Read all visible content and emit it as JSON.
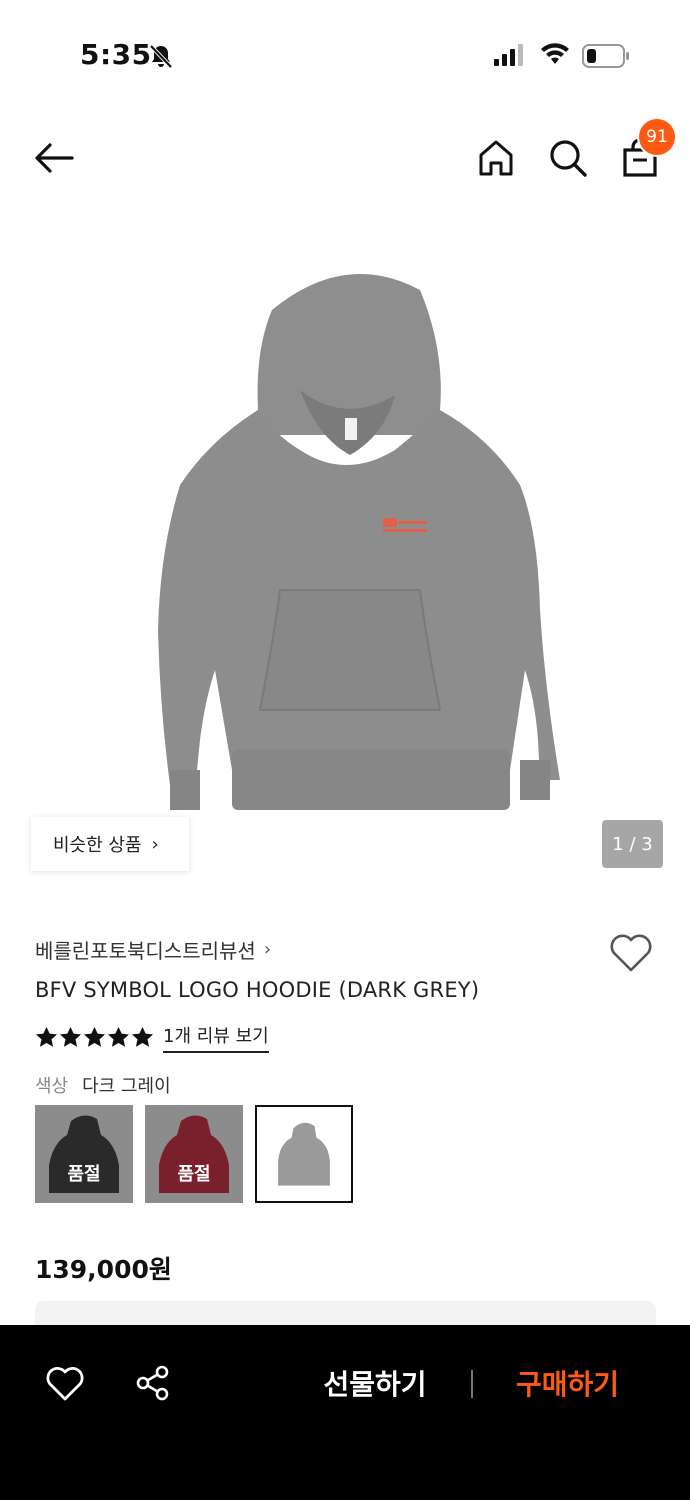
{
  "status_bar": {
    "time": "5:35",
    "icons": [
      "bell-slash-icon",
      "signal-icon",
      "wifi-icon",
      "battery-icon"
    ]
  },
  "header": {
    "icons": [
      "back-arrow-icon",
      "home-icon",
      "search-icon",
      "shopping-bag-icon"
    ],
    "cart_count": "91"
  },
  "gallery": {
    "similar_label": "비슷한 상품",
    "similar_chevron": "›",
    "page_indicator": "1 / 3"
  },
  "product": {
    "brand": "베를린포토북디스트리뷰션",
    "brand_chevron": "›",
    "name": "BFV SYMBOL LOGO HOODIE (DARK GREY)",
    "rating_stars": 5,
    "review_link": "1개 리뷰 보기",
    "color_label": "색상",
    "color_value": "다크 그레이",
    "swatches": [
      {
        "color": "#2a2a2a",
        "status": "품절"
      },
      {
        "color": "#7a1f2c",
        "status": "품절"
      },
      {
        "color": "#9a9a9a",
        "status": ""
      }
    ],
    "price": "139,000원"
  },
  "bottom_bar": {
    "icons": [
      "heart-icon",
      "share-icon"
    ],
    "gift_label": "선물하기",
    "buy_label": "구매하기"
  },
  "colors": {
    "accent": "#ff5a14",
    "bottom_bar_bg": "#000000"
  }
}
